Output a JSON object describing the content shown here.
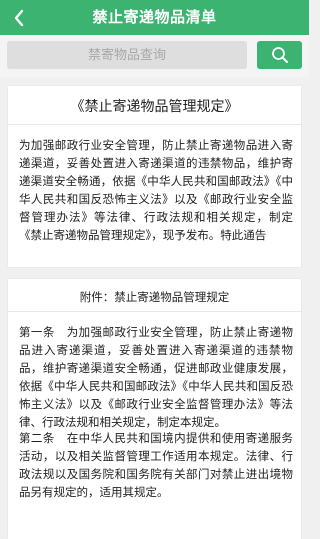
{
  "header": {
    "title": "禁止寄递物品清单",
    "back_icon": "chevron-left-icon"
  },
  "search": {
    "placeholder": "禁寄物品查询",
    "button_icon": "search-icon"
  },
  "document": {
    "title": "《禁止寄递物品管理规定》",
    "intro": "为加强邮政行业安全管理，防止禁止寄递物品进入寄递渠道，妥善处置进入寄递渠道的违禁物品，维护寄递渠道安全畅通，依据《中华人民共和国邮政法》《中华人民共和国反恐怖主义法》以及《邮政行业安全监督管理办法》等法律、行政法规和相关规定，制定《禁止寄递物品管理规定》，现予发布。特此通告"
  },
  "attachment": {
    "title": "附件：禁止寄递物品管理规定",
    "article1": "第一条　为加强邮政行业安全管理，防止禁止寄递物品进入寄递渠道，妥善处置进入寄递渠道的违禁物品，维护寄递渠道安全畅通，促进邮政业健康发展，依据《中华人民共和国邮政法》《中华人民共和国反恐怖主义法》以及《邮政行业安全监督管理办法》等法律、行政法规和相关规定，制定本规定。",
    "article2": "第二条　在中华人民共和国境内提供和使用寄递服务活动，以及相关监督管理工作适用本规定。法律、行政法规以及国务院和国务院有关部门对禁止进出境物品另有规定的，适用其规定。"
  },
  "colors": {
    "accent": "#3cb371",
    "background": "#f0f0f0",
    "search_field": "#dedede"
  }
}
